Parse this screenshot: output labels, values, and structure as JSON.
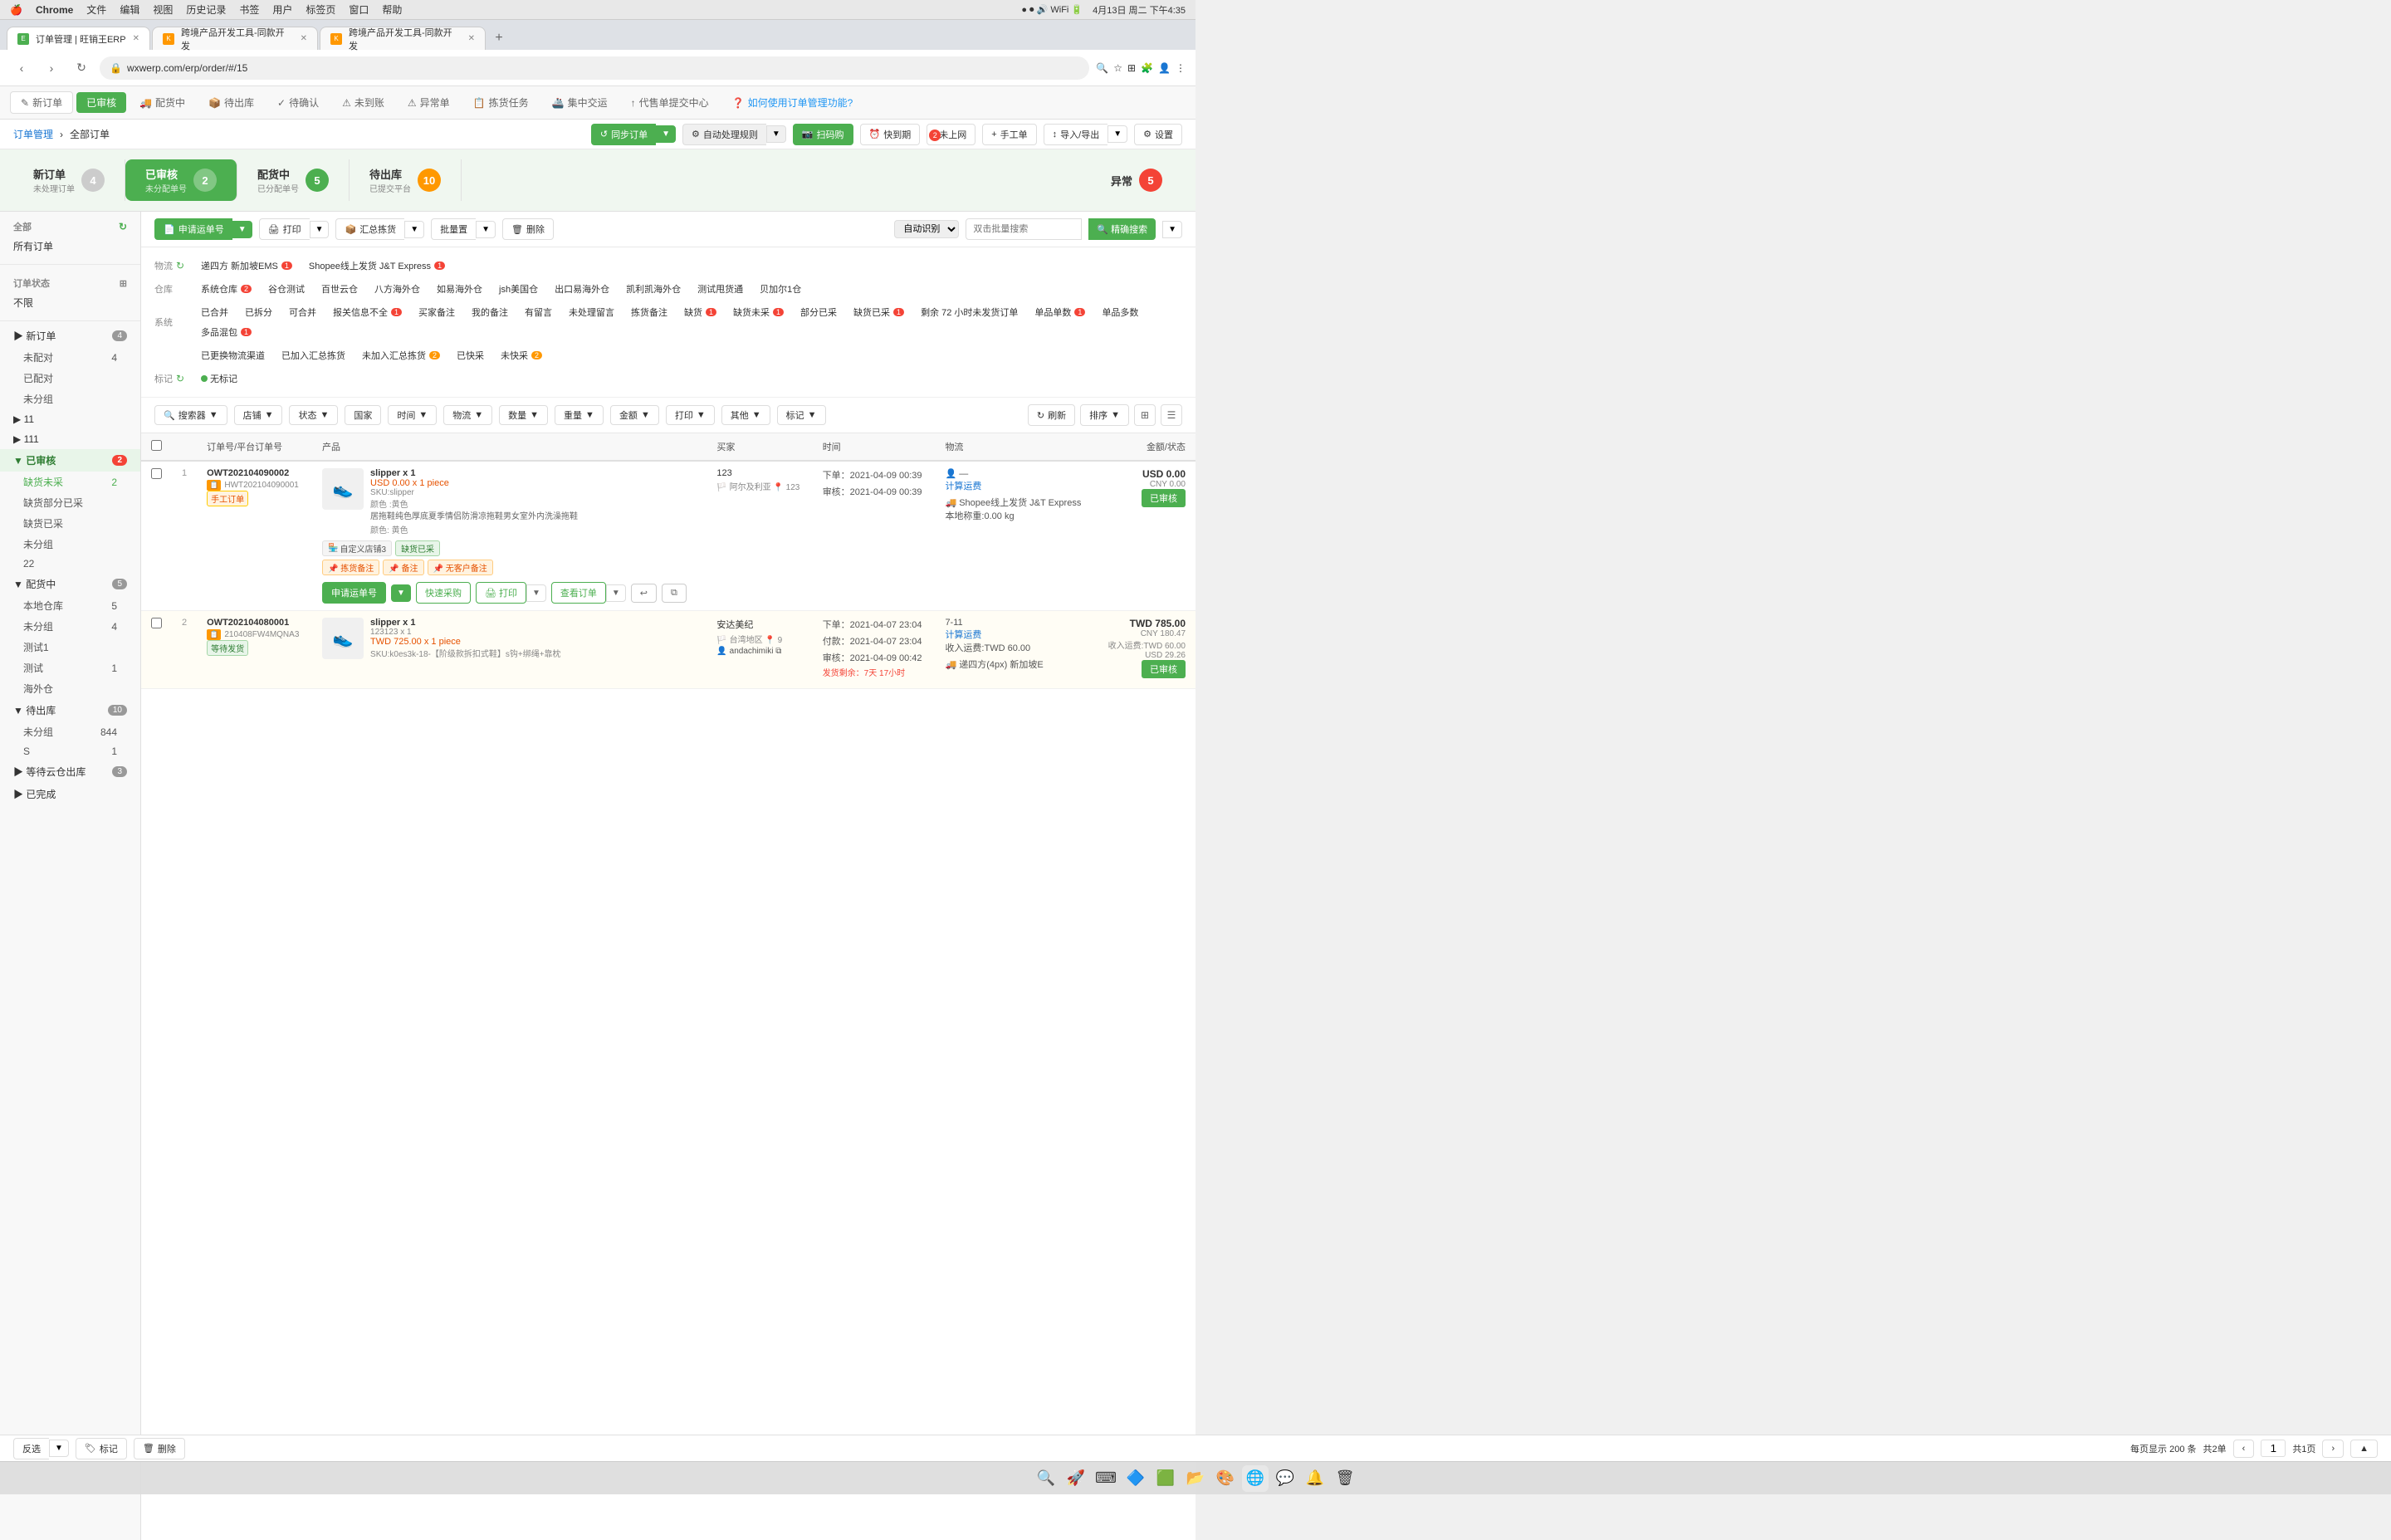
{
  "macMenuBar": {
    "apple": "🍎",
    "appName": "Chrome",
    "menus": [
      "文件",
      "编辑",
      "视图",
      "历史记录",
      "书签",
      "用户",
      "标签页",
      "窗口",
      "帮助"
    ],
    "time": "4月13日 周二 下午4:35"
  },
  "tabs": [
    {
      "id": "t1",
      "label": "订单管理 | 旺销王ERP",
      "url": "wxwerp.com/erp/order/#/15",
      "active": true
    },
    {
      "id": "t2",
      "label": "跨境产品开发工具-同款开发",
      "active": false
    },
    {
      "id": "t3",
      "label": "跨境产品开发工具-同款开发",
      "active": false
    }
  ],
  "addressBar": {
    "url": "wxwerp.com/erp/order/#/15",
    "secure": true
  },
  "appNav": {
    "items": [
      {
        "id": "new",
        "label": "新订单",
        "icon": "✎"
      },
      {
        "id": "reviewed",
        "label": "已审核",
        "active": true
      },
      {
        "id": "shipping",
        "label": "配货中"
      },
      {
        "id": "pending-out",
        "label": "待出库"
      },
      {
        "id": "confirm",
        "label": "待确认"
      },
      {
        "id": "not-arrived",
        "label": "未到账"
      },
      {
        "id": "exception",
        "label": "异常单"
      },
      {
        "id": "batch-goods",
        "label": "拣货任务"
      },
      {
        "id": "combined-ship",
        "label": "集中交运"
      },
      {
        "id": "consign",
        "label": "代售单提交中心"
      },
      {
        "id": "help",
        "label": "如何使用订单管理功能?"
      }
    ]
  },
  "breadcrumb": {
    "parent": "订单管理",
    "current": "全部订单"
  },
  "topActions": {
    "syncOrder": "同步订单",
    "autoProcess": "自动处理规则",
    "scanCode": "扫码购",
    "quickArrive": "快到期",
    "notOnline": "未上网",
    "manualOrder": "手工单",
    "importExport": "导入/导出",
    "settings": "设置"
  },
  "statusCards": [
    {
      "id": "new",
      "title": "新订单",
      "sub": "未处理订单",
      "count": "4",
      "countColor": "gray"
    },
    {
      "id": "reviewed",
      "title": "已审核",
      "sub": "未分配单号",
      "count": "2",
      "active": true,
      "countColor": "white"
    },
    {
      "id": "shipping",
      "title": "配货中",
      "sub": "已分配单号",
      "count": "5",
      "countColor": "green"
    },
    {
      "id": "pending-out",
      "title": "待出库",
      "sub": "已提交平台",
      "count": "10",
      "countColor": "orange"
    },
    {
      "id": "exception",
      "title": "异常",
      "sub": "",
      "count": "5",
      "countColor": "red"
    }
  ],
  "actionBtns": {
    "applyShipping": "申请运单号",
    "print": "打印",
    "batchGoods": "汇总拣货",
    "batch": "批量置",
    "delete": "删除"
  },
  "filterLogistics": {
    "label": "物流",
    "options": [
      "递四方 新加坡EMS",
      "Shopee线上发货 J&T Express"
    ],
    "badges": [
      1,
      1
    ]
  },
  "filterWarehouse": {
    "label": "仓库",
    "options": [
      "系统仓库",
      "谷仓测试",
      "百世云仓",
      "八方海外仓",
      "如易海外仓",
      "jsh美国仓",
      "出口易海外仓",
      "凯利凯海外仓",
      "测试甩货通",
      "贝加尔1仓"
    ],
    "badges": [
      2,
      0,
      0,
      0,
      0,
      0,
      0,
      0,
      0,
      0
    ]
  },
  "filterSystem": {
    "label": "系统",
    "options": [
      "已合并",
      "已拆分",
      "可合并",
      "报关信息不全",
      "买家备注",
      "我的备注",
      "有留言",
      "未处理留言",
      "拣货备注",
      "缺货",
      "缺货未采",
      "部分已采",
      "缺货已采",
      "剩余72小时未发货订单",
      "单品单数",
      "单品多数",
      "多品混包"
    ],
    "badges": [
      0,
      0,
      0,
      1,
      0,
      0,
      0,
      0,
      0,
      1,
      1,
      0,
      1,
      0,
      1,
      0,
      1
    ]
  },
  "filterExtra": {
    "options": [
      "已更换物流渠道",
      "已加入汇总拣货",
      "未加入汇总拣货",
      "已快采",
      "未快采"
    ],
    "badges": [
      0,
      0,
      2,
      0,
      2
    ]
  },
  "filterMark": {
    "label": "标记",
    "options": [
      "无标记"
    ],
    "dotColor": "#4caf50"
  },
  "toolbar": {
    "search": "搜索器",
    "shop": "店铺",
    "status": "状态",
    "country": "国家",
    "time": "时间",
    "logistics": "物流",
    "quantity": "数量",
    "weight": "重量",
    "amount": "金额",
    "print": "打印",
    "other": "其他",
    "mark": "标记",
    "refresh": "刷新",
    "sort": "排序",
    "gridView": "grid",
    "listView": "list"
  },
  "tableHeaders": {
    "checkbox": "",
    "orderNo": "订单号/平台订单号",
    "product": "产品",
    "buyer": "买家",
    "time": "时间",
    "logistics": "物流",
    "amount": "金额/状态"
  },
  "orders": [
    {
      "rowNum": "1",
      "orderNo": "OWT202104090002",
      "platformNo": "HWT202104090001",
      "type": "手工订单",
      "product": {
        "name": "slipper x 1",
        "price": "USD 0.00 x 1 piece",
        "sku": "SKU:slipper",
        "color": "颜色 :黄色",
        "desc": "居拖鞋纯色厚底夏季情侣防滑凉拖鞋男女室外内洗澡拖鞋",
        "colorDetail": "颜色: 黄色"
      },
      "buyer": {
        "id": "123",
        "flag": "🏳️",
        "country": "阿尔及利亚",
        "num": "123"
      },
      "time": {
        "orderTime": "下单：2021-04-09 00:39",
        "reviewTime": "审核：2021-04-09 00:39"
      },
      "logistics": {
        "icon": "👤",
        "calc": "计算运费",
        "carrier": "Shopee线上发货 J&T Express",
        "weight": "本地称重:0.00 kg"
      },
      "amount": {
        "usd": "USD 0.00",
        "cny": "CNY 0.00"
      },
      "status": "已审核",
      "statusColor": "green",
      "tags": [
        "自定义店铺3",
        "缺货已采"
      ],
      "notes": [
        "拣货备注",
        "备注",
        "无客户备注"
      ]
    },
    {
      "rowNum": "2",
      "orderNo": "OWT202104080001",
      "platformNo": "210408FW4MQNA3",
      "type": "等待发货",
      "product": {
        "name": "slipper x 1",
        "price2": "123123 x 1",
        "price": "TWD 725.00 x 1 piece",
        "sku": "SKU:k0es3k-18-【阶级款拆扣式鞋】s钩+绑绳+靠枕",
        "color": "",
        "desc": ""
      },
      "buyer": {
        "id": "安达美纪",
        "flag": "🏳️",
        "country": "台湾地区",
        "num": "9",
        "name": "andachimiki"
      },
      "time": {
        "orderTime": "下单：2021-04-07 23:04",
        "payTime": "付款：2021-04-07 23:04",
        "reviewTime": "审核：2021-04-09 00:42",
        "warn": "发货剩余：7天 17小时"
      },
      "logistics": {
        "carrier": "递四方(4px) 新加坡E",
        "revenue": "收入运费:TWD 60.00",
        "calc": "计算运费",
        "names": "7-11"
      },
      "amount": {
        "twd": "TWD 785.00",
        "cny": "CNY 180.47",
        "revenue": "收入运费:TWD 60.00",
        "usd": "USD 29.26"
      },
      "status": "已审核",
      "statusColor": "green"
    }
  ],
  "bottomBar": {
    "deselect": "反选",
    "mark": "标记",
    "delete": "删除",
    "perPage": "每页显示 200 条",
    "total": "共2单",
    "page": "1",
    "totalPages": "共1页"
  },
  "sidebar": {
    "sections": [
      {
        "label": "全部",
        "refresh": true,
        "items": [
          {
            "label": "所有订单",
            "count": null
          }
        ]
      },
      {
        "label": "订单状态",
        "icon": "⊞",
        "items": [
          {
            "label": "不限",
            "count": null
          }
        ]
      },
      {
        "label": "新订单",
        "count": 4,
        "sub": [
          {
            "label": "未配对",
            "count": 4
          },
          {
            "label": "已配对",
            "count": null
          },
          {
            "label": "未分组",
            "count": null
          }
        ]
      },
      {
        "label": "11",
        "count": null,
        "sub": []
      },
      {
        "label": "111",
        "count": null,
        "sub": []
      },
      {
        "label": "已审核",
        "count": 2,
        "active": true,
        "sub": [
          {
            "label": "缺货未采",
            "count": 2
          },
          {
            "label": "缺货部分已采",
            "count": null
          },
          {
            "label": "缺货已采",
            "count": null
          },
          {
            "label": "未分组",
            "count": null
          },
          {
            "label": "22",
            "count": null
          }
        ]
      },
      {
        "label": "配货中",
        "count": 5,
        "sub": [
          {
            "label": "本地仓库",
            "count": 5
          },
          {
            "label": "未分组",
            "count": 4
          },
          {
            "label": "测试1",
            "count": null
          },
          {
            "label": "测试",
            "count": 1
          },
          {
            "label": "海外仓",
            "count": null
          }
        ]
      },
      {
        "label": "待出库",
        "count": 10,
        "sub": [
          {
            "label": "未分组",
            "count": 844
          },
          {
            "label": "S",
            "count": 1
          }
        ]
      },
      {
        "label": "等待云仓出库",
        "count": 3,
        "sub": []
      },
      {
        "label": "已完成",
        "count": null,
        "sub": []
      }
    ]
  }
}
